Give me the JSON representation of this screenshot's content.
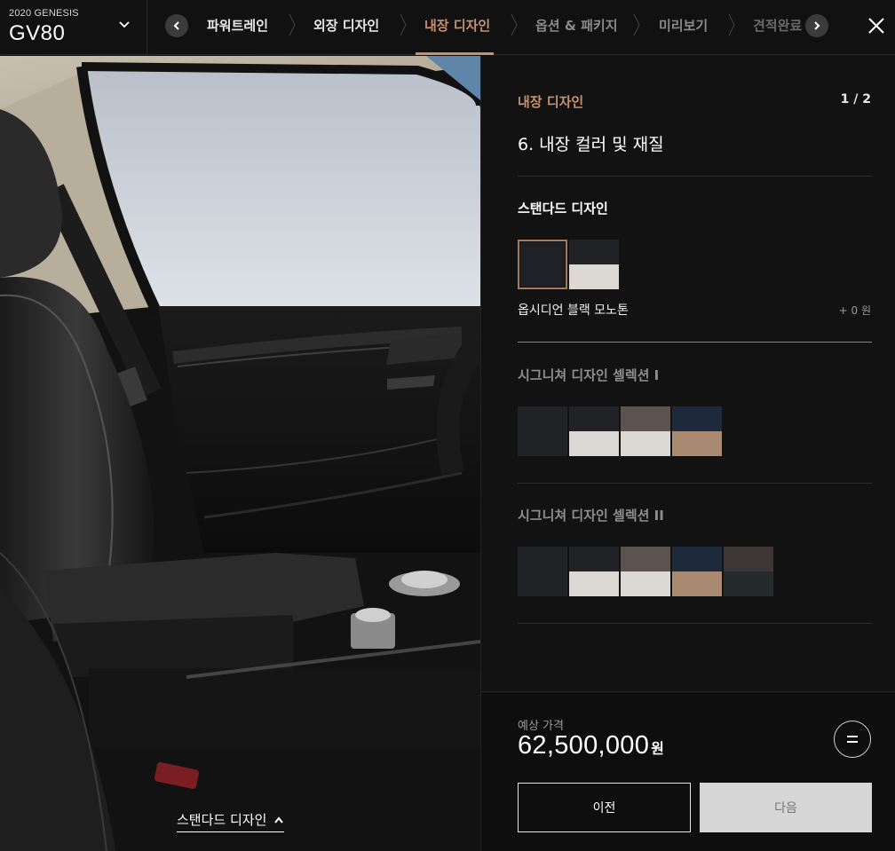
{
  "header": {
    "model_year": "2020 GENESIS",
    "model_name": "GV80",
    "steps": [
      {
        "label": "파워트레인",
        "state": "done"
      },
      {
        "label": "외장 디자인",
        "state": "done"
      },
      {
        "label": "내장 디자인",
        "state": "active"
      },
      {
        "label": "옵션 & 패키지",
        "state": "todo"
      },
      {
        "label": "미리보기",
        "state": "todo"
      },
      {
        "label": "견적완료",
        "state": "todo"
      }
    ],
    "icons": {
      "model_toggle": "chevron-down-icon",
      "prev": "chevron-left-icon",
      "next": "chevron-right-icon",
      "close": "close-icon"
    }
  },
  "image_panel": {
    "caption": "스탠다드 디자인",
    "caption_icon": "chevron-up-icon"
  },
  "panel": {
    "section_label": "내장 디자인",
    "page_indicator": "1 / 2",
    "step_title": "6. 내장 컬러 및 재질",
    "groups": [
      {
        "title": "스탠다드 디자인",
        "swatches": [
          {
            "top": "#1f2126",
            "bottom": "#1f2126",
            "selected": true
          },
          {
            "top": "#202226",
            "bottom": "#dcd8d4",
            "selected": false
          }
        ]
      },
      {
        "title": "시그니쳐 디자인 셀렉션 I",
        "swatches": [
          {
            "top": "#202226",
            "bottom": "#202226"
          },
          {
            "top": "#202226",
            "bottom": "#dcd8d4"
          },
          {
            "top": "#5c5250",
            "bottom": "#dcd8d4"
          },
          {
            "top": "#1e2a3c",
            "bottom": "#a98a70"
          }
        ]
      },
      {
        "title": "시그니쳐 디자인 셀렉션 II",
        "swatches": [
          {
            "top": "#202226",
            "bottom": "#202226"
          },
          {
            "top": "#202226",
            "bottom": "#dcd8d4"
          },
          {
            "top": "#5c5250",
            "bottom": "#dcd8d4"
          },
          {
            "top": "#1e2a3c",
            "bottom": "#a98a70"
          },
          {
            "top": "#3d3636",
            "bottom": "#232c2a"
          }
        ]
      }
    ],
    "selected_name": "옵시디언 블랙 모노톤",
    "selected_price": "+ 0 원"
  },
  "price": {
    "label": "예상 가격",
    "value": "62,500,000",
    "unit": "원",
    "summary_icon": "equals-icon"
  },
  "buttons": {
    "prev": "이전",
    "next": "다음"
  },
  "colors": {
    "accent": "#c8916e",
    "background": "#121212"
  }
}
